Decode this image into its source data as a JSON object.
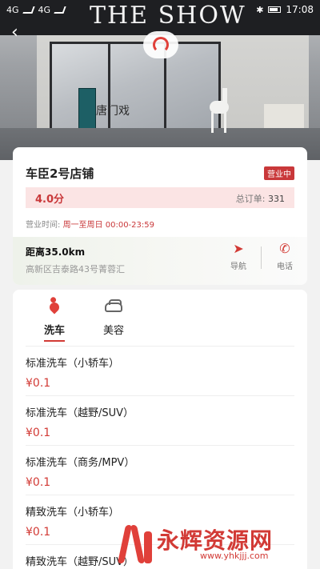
{
  "status_bar": {
    "left": [
      "4G",
      "4G"
    ],
    "time": "17:08"
  },
  "hero": {
    "sign_text": "THE SHOW",
    "door_sign": "唐门戏"
  },
  "store": {
    "name": "车臣2号店铺",
    "status_badge": "营业中",
    "rating": "4.0分",
    "orders_label": "总订单:",
    "orders_value": "331",
    "hours_label": "营业时间:",
    "hours_value": "周一至周日 00:00-23:59",
    "distance": "距离35.0km",
    "address": "高新区吉泰路43号菁蓉汇",
    "actions": {
      "navigate_label": "导航",
      "phone_label": "电话",
      "navigate_icon": "send-icon",
      "phone_icon": "phone-icon"
    }
  },
  "services": {
    "tabs": [
      {
        "label": "洗车",
        "icon": "water-drop-icon",
        "active": true
      },
      {
        "label": "美容",
        "icon": "car-icon",
        "active": false
      }
    ],
    "items": [
      {
        "name": "标准洗车（小轿车）",
        "price": "¥0.1"
      },
      {
        "name": "标准洗车（越野/SUV）",
        "price": "¥0.1"
      },
      {
        "name": "标准洗车（商务/MPV）",
        "price": "¥0.1"
      },
      {
        "name": "精致洗车（小轿车）",
        "price": "¥0.1"
      },
      {
        "name": "精致洗车（越野/SUV）",
        "price": ""
      }
    ]
  },
  "watermark": {
    "title": "永辉资源网",
    "url": "www.yhkjjj.com"
  },
  "colors": {
    "accent": "#d23a35",
    "badge": "#c9383a",
    "rating_bg": "#fbe4e4"
  }
}
